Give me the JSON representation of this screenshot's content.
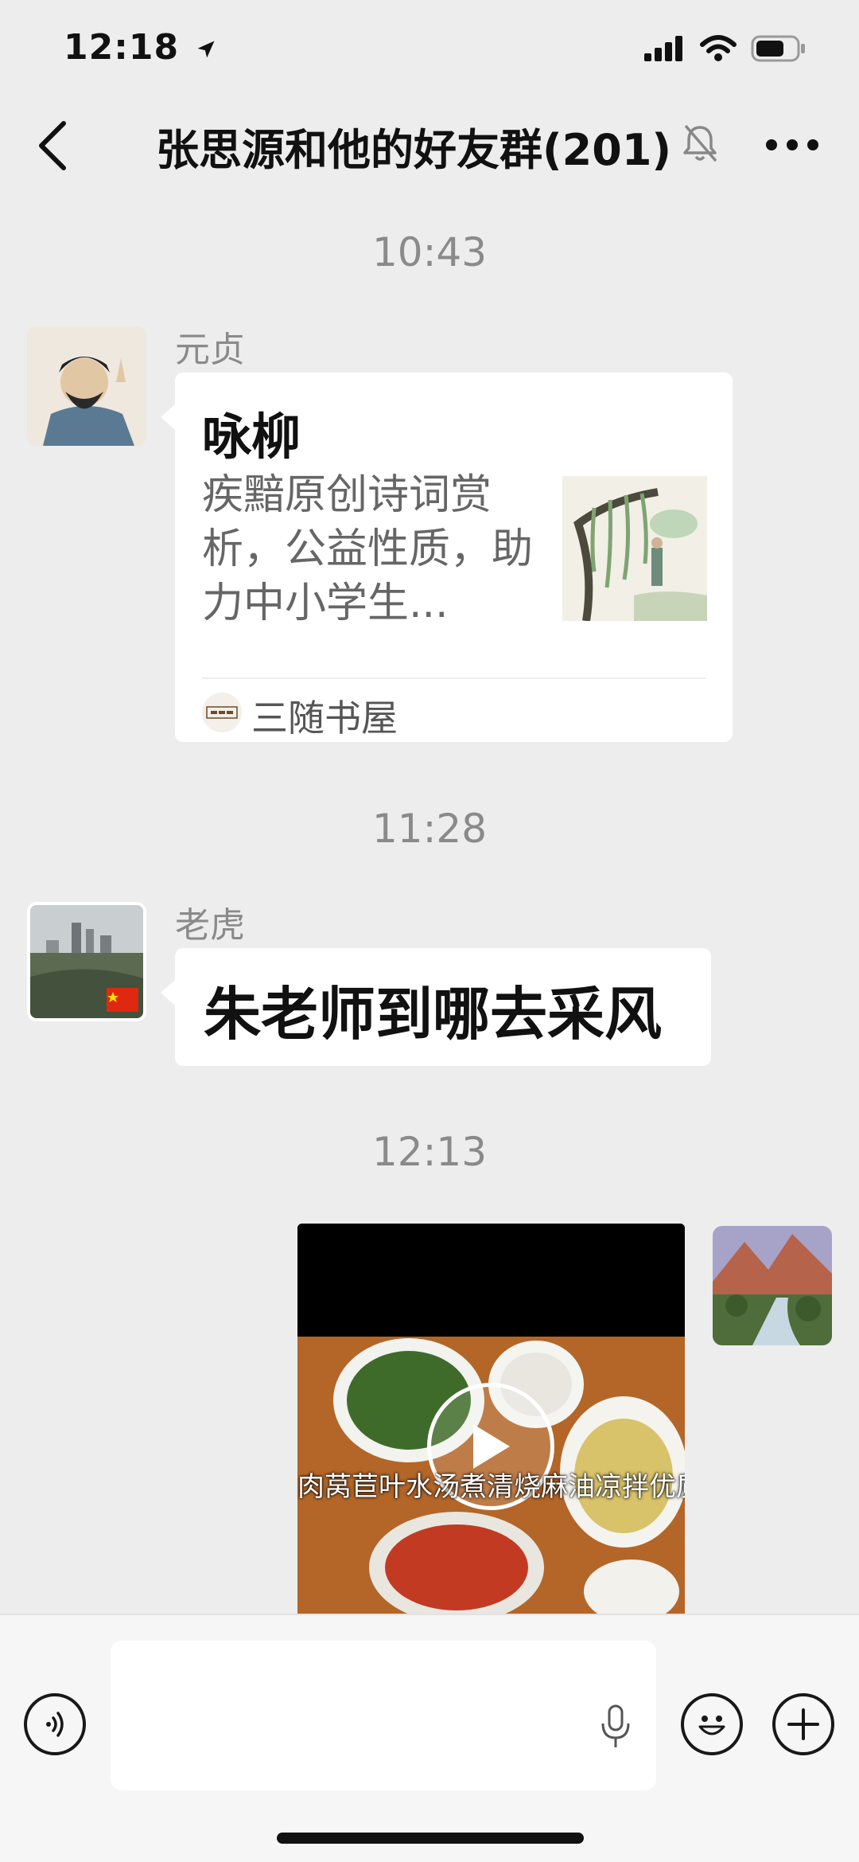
{
  "status_bar": {
    "time": "12:18"
  },
  "header": {
    "title": "张思源和他的好友群(201)"
  },
  "messages": [
    {
      "timestamp": "10:43",
      "sender": "元贞",
      "type": "link_card",
      "card": {
        "title": "咏柳",
        "description": "疾黯原创诗词赏析，公益性质，助力中小学生...",
        "source": "三随书屋"
      }
    },
    {
      "timestamp": "11:28",
      "sender": "老虎",
      "type": "text",
      "text": "朱老师到哪去采风"
    },
    {
      "timestamp": "12:13",
      "type": "video",
      "caption": "肉莴苣叶水汤煮清烧麻油凉拌优质"
    }
  ],
  "input": {
    "placeholder": ""
  },
  "colors": {
    "background": "#ededed",
    "bubble": "#ffffff",
    "timestamp": "#8a8a8a"
  }
}
